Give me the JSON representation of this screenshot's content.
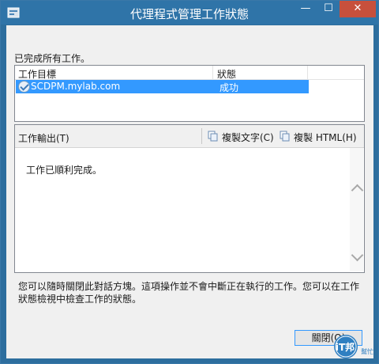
{
  "window": {
    "title": "代理程式管理工作狀態",
    "controls": {
      "minimize": "—",
      "maximize": "☐",
      "close": "✕"
    }
  },
  "status_message": "已完成所有工作。",
  "task_list": {
    "columns": [
      "工作目標",
      "狀態"
    ],
    "rows": [
      {
        "target": "SCDPM.mylab.com",
        "status": "成功",
        "icon": "success-check-icon",
        "selected": true
      }
    ]
  },
  "output": {
    "label": "工作輸出(T)",
    "copy_text_label": "複製文字(C)",
    "copy_html_label": "複製 HTML(H)",
    "text": "工作已順利完成。"
  },
  "notice": "您可以隨時關閉此對話方塊。這項操作並不會中斷正在執行的工作。您可以在工作狀態檢視中檢查工作的狀態。",
  "close_button": "關閉(O)",
  "watermark": {
    "line1": "iT邦",
    "line2": "幫忙"
  },
  "colors": {
    "titlebar": "#2f74a8",
    "selection": "#3399ff",
    "close": "#c7503c"
  }
}
